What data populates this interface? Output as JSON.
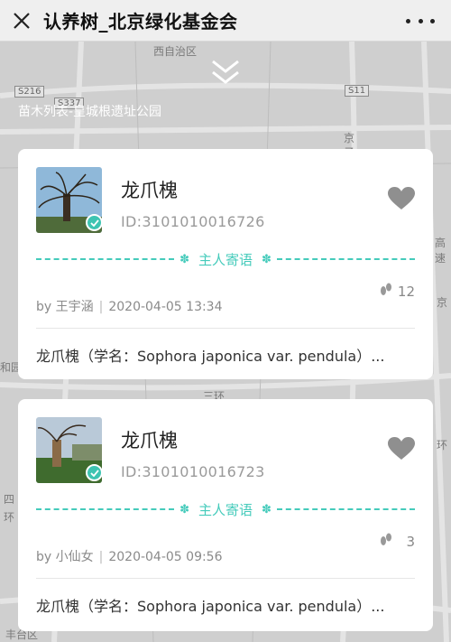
{
  "header": {
    "title": "认养树_北京绿化基金会"
  },
  "map": {
    "labels": [
      "西自治区",
      "S216",
      "S11",
      "S337",
      "京",
      "子",
      "高速",
      "京",
      "三环",
      "和园",
      "四",
      "环",
      "环",
      "丰台区"
    ]
  },
  "location_text": "苗木列表-皇城根遗址公园",
  "divider_label": "主人寄语",
  "trees": [
    {
      "name": "龙爪槐",
      "id": "ID:3101010016726",
      "author": "by 王宇涵",
      "datetime": "2020-04-05 13:34",
      "steps": "12",
      "description": "龙爪槐（学名：Sophora japonica var. pendula）..."
    },
    {
      "name": "龙爪槐",
      "id": "ID:3101010016723",
      "author": "by 小仙女",
      "datetime": "2020-04-05 09:56",
      "steps": "3",
      "description": "龙爪槐（学名：Sophora japonica var. pendula）..."
    }
  ],
  "colors": {
    "accent": "#45cbbb",
    "heart": "#8f8f8f",
    "topbar": "#efefef"
  }
}
